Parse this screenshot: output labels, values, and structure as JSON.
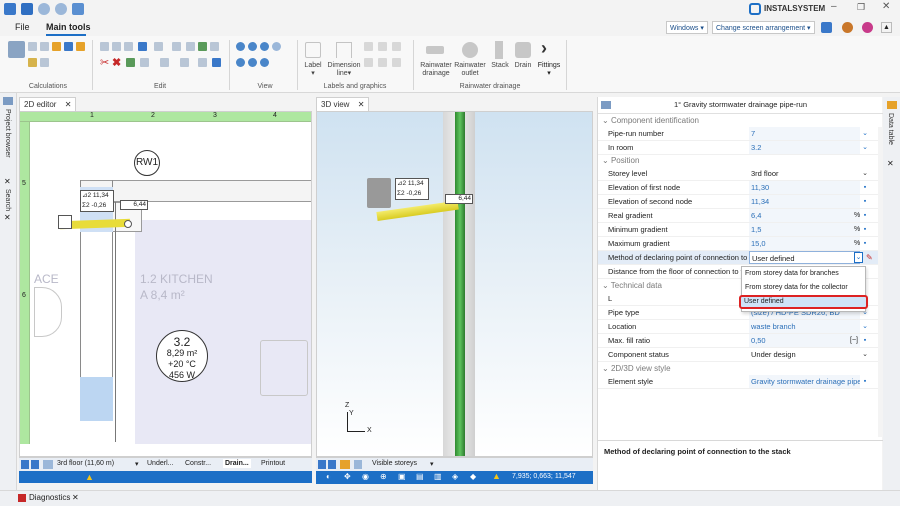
{
  "quick_access": {
    "icons": [
      "folder-icon",
      "save-icon",
      "undo-icon",
      "redo-icon",
      "cloud-icon"
    ]
  },
  "brand": {
    "name": "INSTALSYSTEM"
  },
  "window_controls": [
    "minimize-icon",
    "restore-icon",
    "close-icon"
  ],
  "menu": {
    "file": "File",
    "main_tools": "Main tools"
  },
  "top_right": {
    "windows": "Windows ▾",
    "arrangement": "Change screen arrangement ▾"
  },
  "ribbon": {
    "groups": [
      "Calculations",
      "Edit",
      "View",
      "Labels and graphics",
      "Rainwater drainage"
    ],
    "big_buttons": [
      {
        "label": "Label\n▾"
      },
      {
        "label": "Dimension\nline▾"
      },
      {
        "label": "Rainwater\ndrainage"
      },
      {
        "label": "Rainwater\noutlet"
      },
      {
        "label": "Stack"
      },
      {
        "label": "Drain"
      },
      {
        "label": "Fittings\n▾"
      }
    ]
  },
  "left_tabs": {
    "project_browser": "Project browser",
    "search": "Search"
  },
  "tabs": {
    "editor2d": "2D editor",
    "view3d": "3D view"
  },
  "editor2d": {
    "ruler_marks": [
      "1",
      "2",
      "3",
      "4",
      "5",
      "6"
    ],
    "outlet_label": "RW1",
    "tag_elev1": "11,34",
    "tag_elev2": "-0,26",
    "tag_grad": "6,44",
    "tag_e1": "⊿2",
    "tag_e2": "Σ2",
    "room_ghost_name": "1.2  KITCHEN",
    "room_ghost_area": "A  8,4 m²",
    "room_ghost_left": "ACE",
    "room_num": "3.2",
    "room_area": "8,29 m²",
    "room_temp": "+20 °C",
    "room_power": "456 W",
    "bottom": {
      "floor": "3rd floor (11,60 m)",
      "tabs": [
        "Underl...",
        "Constr...",
        "Drain...",
        "Printout"
      ]
    }
  },
  "view3d": {
    "tag_elev1": "11,34",
    "tag_elev2": "-0,26",
    "tag_grad": "6,44",
    "tag_e1": "⊿2",
    "tag_e2": "Σ2",
    "axis_z": "Z",
    "axis_y": "Y",
    "axis_x": "X",
    "bottom": {
      "visible": "Visible storeys"
    },
    "status_coords": "7,935; 0,663; 11,547"
  },
  "properties": {
    "title": "1° Gravity stormwater drainage pipe-run",
    "side_tab": "Data table",
    "sections": {
      "component": "Component identification",
      "position": "Position",
      "technical": "Technical data",
      "view": "2D/3D view style"
    },
    "rows": {
      "pipe_run_number": {
        "name": "Pipe-run number",
        "value": "7"
      },
      "in_room": {
        "name": "In room",
        "value": "3.2"
      },
      "storey_level": {
        "name": "Storey level",
        "value": "3rd floor"
      },
      "elev_first": {
        "name": "Elevation of first node",
        "value": "11,30"
      },
      "elev_second": {
        "name": "Elevation of second node",
        "value": "11,34"
      },
      "real_gradient": {
        "name": "Real gradient",
        "value": "6,4",
        "unit": "%"
      },
      "min_gradient": {
        "name": "Minimum gradient",
        "value": "1,5",
        "unit": "%"
      },
      "max_gradient": {
        "name": "Maximum gradient",
        "value": "15,0",
        "unit": "%"
      },
      "method": {
        "name": "Method of declaring point of connection to t",
        "value": "User defined"
      },
      "distance": {
        "name": "Distance from the floor of connection to the"
      },
      "l": {
        "name": "L"
      },
      "pipe_type": {
        "name": "Pipe type",
        "value": "(size) / HD-PE SDR26, BD"
      },
      "location": {
        "name": "Location",
        "value": "waste branch"
      },
      "max_fill": {
        "name": "Max. fill ratio",
        "value": "0,50",
        "unit": "[~]"
      },
      "status": {
        "name": "Component status",
        "value": "Under design"
      },
      "element_style": {
        "name": "Element style",
        "value": "Gravity stormwater drainage pipe"
      }
    },
    "dropdown": {
      "options": [
        "From storey data for branches",
        "From storey data for the collector",
        "User defined"
      ],
      "selected": "User defined"
    },
    "description": "Method of declaring point of connection to the stack"
  },
  "bottom": {
    "diagnostics": "Diagnostics"
  },
  "colors": {
    "accent": "#1d6fc6",
    "pipe": "#e8dc3a",
    "stack": "#3c9a3c",
    "highlight": "#d22"
  }
}
